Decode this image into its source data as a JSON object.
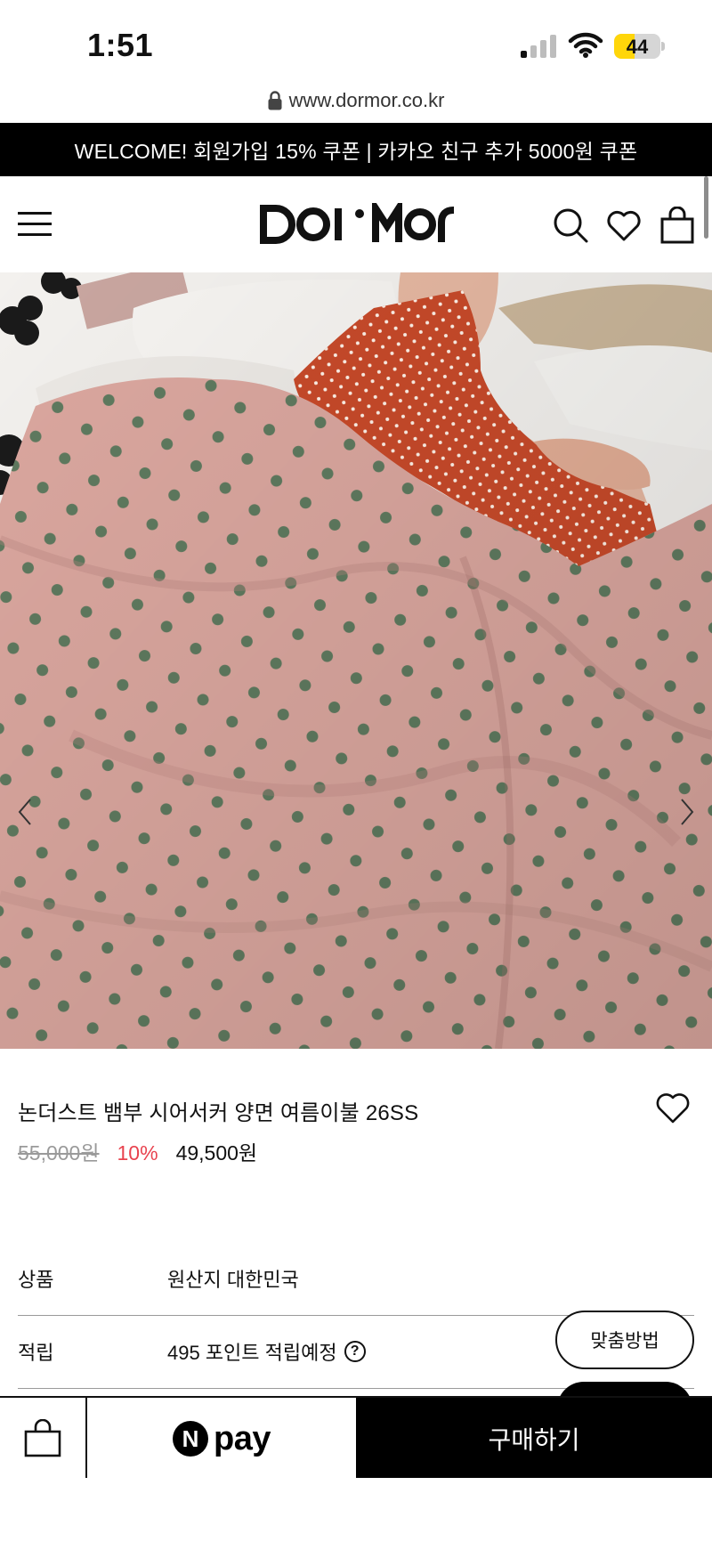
{
  "status_bar": {
    "time": "1:51",
    "battery": "44",
    "battery_level": 0.44
  },
  "browser": {
    "url": "www.dormor.co.kr"
  },
  "promo_banner": {
    "text": "WELCOME! 회원가입 15% 쿠폰 | 카카오 친구 추가 5000원 쿠폰"
  },
  "header": {
    "logo_text": "DOI•MOƳ",
    "icons": [
      "menu-icon",
      "search-icon",
      "heart-icon",
      "shopping-bag-icon"
    ]
  },
  "product": {
    "title": "논더스트 뱀부 시어서커 양면 여름이불 26SS",
    "original_price": "55,000원",
    "discount": "10%",
    "final_price": "49,500원",
    "image_icon": "pink-polka-dot-duvet-photo"
  },
  "info": {
    "rows": [
      {
        "label": "상품",
        "value": "원산지 대한민국"
      },
      {
        "label": "적립",
        "value": "495 포인트 적립예정",
        "icon": "help-icon"
      }
    ]
  },
  "floating": {
    "fit_button": "맞춤방법"
  },
  "bottom_bar": {
    "npay_n": "N",
    "npay_label": "pay",
    "buy_label": "구매하기"
  },
  "colors": {
    "accent_discount": "#e8434f",
    "banner_bg": "#000000",
    "buy_bg": "#000000"
  }
}
